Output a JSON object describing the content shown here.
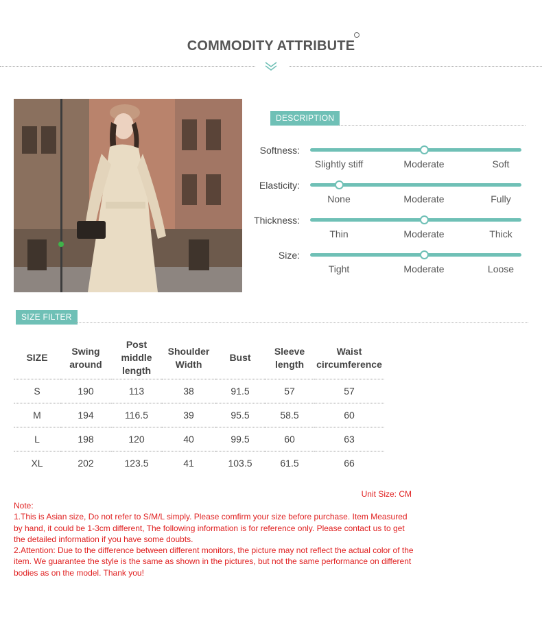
{
  "header": {
    "title": "COMMODITY ATTRIBUTE"
  },
  "photo": {
    "alt": "Model in beige long-sleeve dress with beret on a city street"
  },
  "description": {
    "tag": "DESCRIPTION",
    "attributes": [
      {
        "label": "Softness:",
        "options": [
          "Slightly stiff",
          "Moderate",
          "Soft"
        ],
        "selected": 1
      },
      {
        "label": "Elasticity:",
        "options": [
          "None",
          "Moderate",
          "Fully"
        ],
        "selected": 0
      },
      {
        "label": "Thickness:",
        "options": [
          "Thin",
          "Moderate",
          "Thick"
        ],
        "selected": 1
      },
      {
        "label": "Size:",
        "options": [
          "Tight",
          "Moderate",
          "Loose"
        ],
        "selected": 1
      }
    ]
  },
  "size_filter": {
    "tag": "SIZE FILTER",
    "headers": [
      "SIZE",
      "Swing around",
      "Post middle length",
      "Shoulder Width",
      "Bust",
      "Sleeve length",
      "Waist circumference"
    ],
    "rows": [
      [
        "S",
        "190",
        "113",
        "38",
        "91.5",
        "57",
        "57"
      ],
      [
        "M",
        "194",
        "116.5",
        "39",
        "95.5",
        "58.5",
        "60"
      ],
      [
        "L",
        "198",
        "120",
        "40",
        "99.5",
        "60",
        "63"
      ],
      [
        "XL",
        "202",
        "123.5",
        "41",
        "103.5",
        "61.5",
        "66"
      ]
    ],
    "unit": "Unit Size: CM"
  },
  "notes": {
    "title": "Note:",
    "line1": "1.This is Asian size, Do not refer to S/M/L simply. Please comfirm your size before purchase. Item Measured by hand, it could be 1-3cm different, The following information is for reference only. Please contact us to get the detailed information if you have some doubts.",
    "line2": "2.Attention: Due to the difference between different monitors, the picture may not reflect the actual color of the item. We guarantee the style is the same as shown in the pictures, but not the same performance on different bodies as on the model. Thank you!"
  },
  "colors": {
    "accent": "#6fc0b6",
    "note": "#e02020",
    "text": "#444444"
  }
}
